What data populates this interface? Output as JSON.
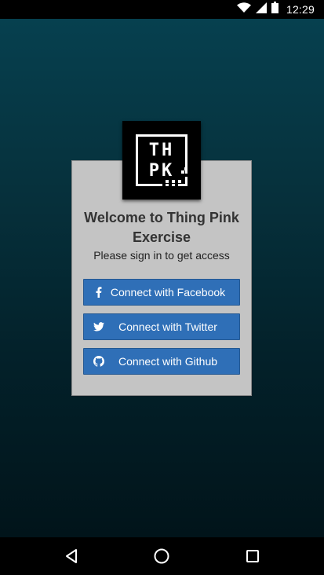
{
  "status_bar": {
    "time": "12:29",
    "icons": [
      "wifi-icon",
      "cell-signal-icon",
      "battery-icon"
    ]
  },
  "logo": {
    "line1": "TH",
    "line2": "PK"
  },
  "login": {
    "title": "Welcome to Thing Pink Exercise",
    "subtitle": "Please sign in to get access",
    "buttons": [
      {
        "label": "Connect with Facebook",
        "icon": "facebook-icon"
      },
      {
        "label": "Connect with Twitter",
        "icon": "twitter-icon"
      },
      {
        "label": "Connect with Github",
        "icon": "github-icon"
      }
    ]
  },
  "nav": {
    "items": [
      "back-icon",
      "home-icon",
      "recents-icon"
    ]
  },
  "colors": {
    "button_bg": "#2f6fb7",
    "card_bg": "#c4c4c4",
    "background_top": "#06404f",
    "background_bottom": "#01141a"
  }
}
